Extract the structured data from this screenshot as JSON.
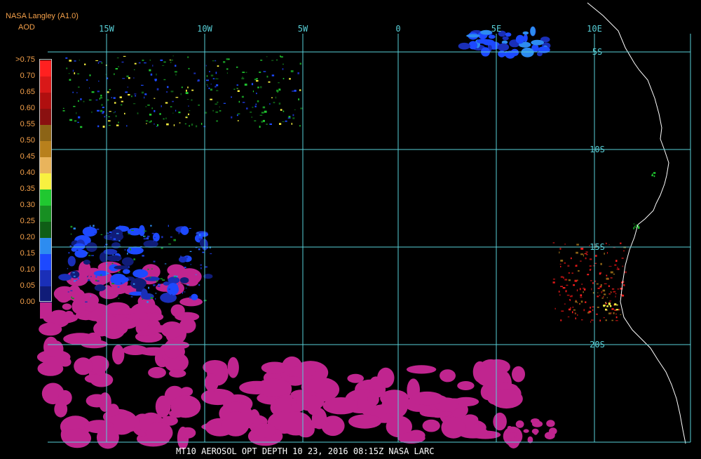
{
  "header": {
    "title": "NASA Langley (A1.0)",
    "subtitle": "AOD"
  },
  "footer": {
    "caption": "MT10  AEROSOL OPT DEPTH   10 23, 2016 08:15Z   NASA LARC"
  },
  "map": {
    "longitude_labels": [
      "15W",
      "10W",
      "5W",
      "0",
      "5E",
      "10E"
    ],
    "latitude_labels": [
      "5S",
      "10S",
      "15S",
      "20S"
    ],
    "colors": {
      "grid": "#58d0d8",
      "coast": "#ffffff",
      "low_aod": "#c0258f",
      "background": "#000000"
    }
  },
  "legend": {
    "items": [
      {
        "label": ">0.75",
        "color": "#ff2020"
      },
      {
        "label": "0.70",
        "color": "#d91818"
      },
      {
        "label": "0.65",
        "color": "#b00f0f"
      },
      {
        "label": "0.60",
        "color": "#8a1010"
      },
      {
        "label": "0.55",
        "color": "#8c6416"
      },
      {
        "label": "0.50",
        "color": "#b8801c"
      },
      {
        "label": "0.45",
        "color": "#e9b45c"
      },
      {
        "label": "0.40",
        "color": "#f8f040"
      },
      {
        "label": "0.35",
        "color": "#20c830"
      },
      {
        "label": "0.30",
        "color": "#178f22"
      },
      {
        "label": "0.25",
        "color": "#0f5e16"
      },
      {
        "label": "0.20",
        "color": "#2d8cf0"
      },
      {
        "label": "0.15",
        "color": "#1d49ff"
      },
      {
        "label": "0.10",
        "color": "#1a2fb8"
      },
      {
        "label": "0.05",
        "color": "#101c78"
      },
      {
        "label": "0.00",
        "color": "#c0258f"
      }
    ]
  }
}
